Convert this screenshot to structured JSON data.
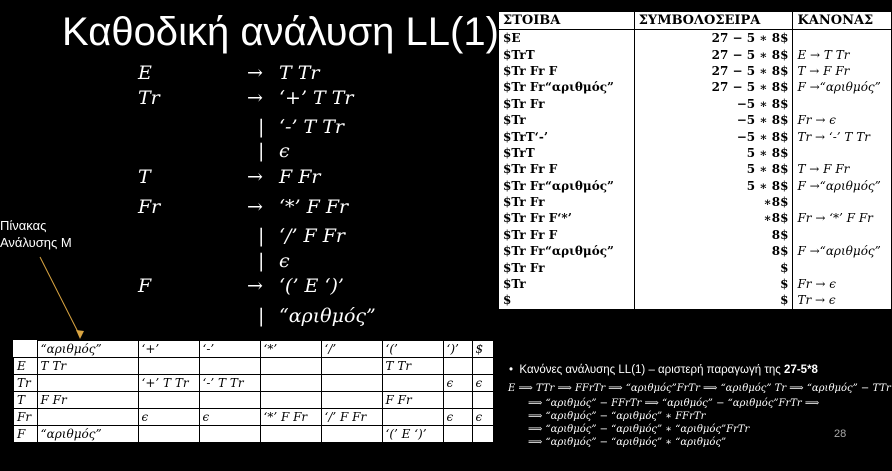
{
  "title": "Καθοδική ανάλυση LL(1)",
  "grammar": [
    {
      "lhs": "E",
      "sep": "→",
      "rhs": "T Tr"
    },
    {
      "lhs": "Tr",
      "sep": "→",
      "rhs": "‘+’ T Tr"
    },
    {
      "lhs": "",
      "sep": "|",
      "rhs": "‘-’ T Tr"
    },
    {
      "lhs": "",
      "sep": "|",
      "rhs": "ϵ"
    },
    {
      "lhs": "T",
      "sep": "→",
      "rhs": "F Fr"
    },
    {
      "lhs": "Fr",
      "sep": "→",
      "rhs": "‘*’ F Fr"
    },
    {
      "lhs": "",
      "sep": "|",
      "rhs": "‘/’ F Fr"
    },
    {
      "lhs": "",
      "sep": "|",
      "rhs": "ϵ"
    },
    {
      "lhs": "F",
      "sep": "→",
      "rhs": "‘(’ E ‘)’"
    },
    {
      "lhs": "",
      "sep": "|",
      "rhs": "“αριθμός”"
    }
  ],
  "side_label": {
    "line1": "Πίνακας",
    "line2": "Ανάλυσης M"
  },
  "parse_table": {
    "header": [
      "",
      "“αριθμός”",
      "‘+’",
      "‘-’",
      "‘*’",
      "‘/’",
      "‘(’",
      "‘)’",
      "$"
    ],
    "rows": [
      [
        "E",
        "T Tr",
        "",
        "",
        "",
        "",
        "T Tr",
        "",
        ""
      ],
      [
        "Tr",
        "",
        "‘+’ T Tr",
        "‘-’ T Tr",
        "",
        "",
        "",
        "ϵ",
        "ϵ"
      ],
      [
        "T",
        "F Fr",
        "",
        "",
        "",
        "",
        "F Fr",
        "",
        ""
      ],
      [
        "Fr",
        "",
        "ϵ",
        "ϵ",
        "‘*’ F Fr",
        "‘/’ F Fr",
        "",
        "ϵ",
        "ϵ"
      ],
      [
        "F",
        "“αριθμός”",
        "",
        "",
        "",
        "",
        "‘(’ E ‘)’",
        "",
        ""
      ]
    ]
  },
  "trace": {
    "headers": [
      "ΣΤΟΙΒΑ",
      "ΣΥΜΒΟΛΟΣΕΙΡΑ",
      "ΚΑΝΟΝΑΣ"
    ],
    "rows": [
      [
        "$E",
        "27 − 5 ∗ 8$",
        ""
      ],
      [
        "$TrT",
        "27 − 5 ∗ 8$",
        "E → T Tr"
      ],
      [
        "$Tr Fr F",
        "27 − 5 ∗ 8$",
        "T → F Fr"
      ],
      [
        "$Tr Fr“αριθμός”",
        "27 − 5 ∗ 8$",
        "F →“αριθμός”"
      ],
      [
        "$Tr Fr",
        "−5 ∗ 8$",
        ""
      ],
      [
        "$Tr",
        "−5 ∗ 8$",
        "Fr → ϵ"
      ],
      [
        "$TrT‘-’",
        "−5 ∗ 8$",
        "Tr → ‘-’ T Tr"
      ],
      [
        "$TrT",
        "5 ∗ 8$",
        ""
      ],
      [
        "$Tr Fr F",
        "5 ∗ 8$",
        "T → F Fr"
      ],
      [
        "$Tr Fr“αριθμός”",
        "5 ∗ 8$",
        "F →“αριθμός”"
      ],
      [
        "$Tr Fr",
        "∗8$",
        ""
      ],
      [
        "$Tr Fr F‘*’",
        "∗8$",
        "Fr → ‘*’ F Fr"
      ],
      [
        "$Tr Fr F",
        "8$",
        ""
      ],
      [
        "$Tr Fr“αριθμός”",
        "8$",
        "F →“αριθμός”"
      ],
      [
        "$Tr Fr",
        "$",
        ""
      ],
      [
        "$Tr",
        "$",
        "Fr → ϵ"
      ],
      [
        "$",
        "$",
        "Tr → ϵ"
      ]
    ]
  },
  "bullet_text": "Κανόνες ανάλυσης LL(1) – αριστερή παραγωγή της ",
  "bullet_bold": "27-5*8",
  "derivation": [
    "E ⟹ TTr ⟹ FFrTr ⟹ “αριθμός”FrTr ⟹ “αριθμός” Tr ⟹ “αριθμός” − TTr",
    "⟹ “αριθμός” − FFrTr ⟹ “αριθμός” − “αριθμός”FrTr ⟹",
    "⟹ “αριθμός” − “αριθμός” ∗ FFrTr",
    "⟹ “αριθμός” − “αριθμός” ∗ “αριθμός”FrTr",
    "⟹ “αριθμός” − “αριθμός” ∗ “αριθμός”"
  ],
  "page_number": "28"
}
